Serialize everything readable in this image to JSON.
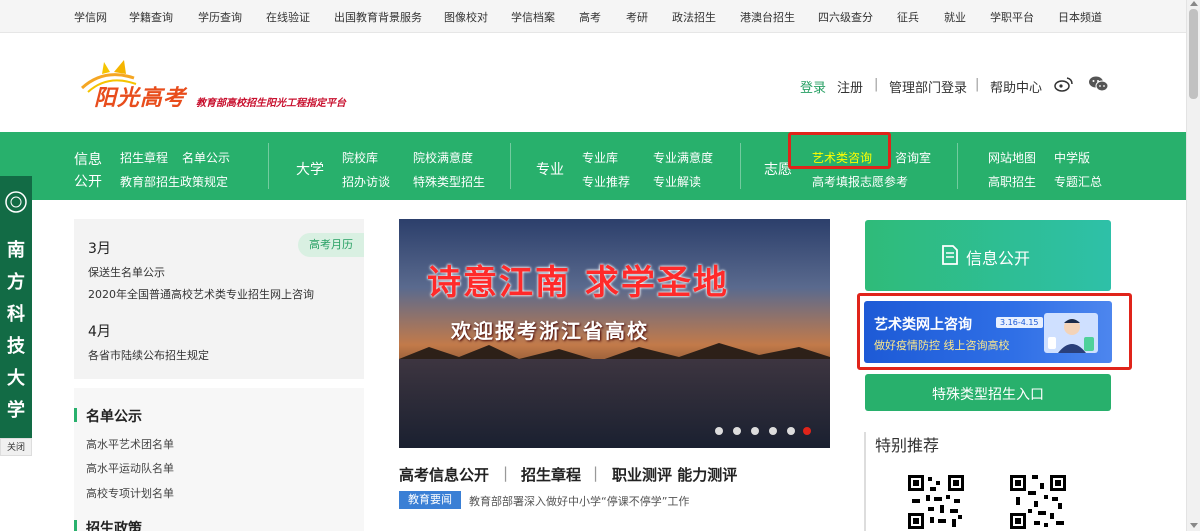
{
  "top_links": [
    "学信网",
    "学籍查询",
    "学历查询",
    "在线验证",
    "出国教育背景服务",
    "图像校对",
    "学信档案",
    "高考",
    "考研",
    "政法招生",
    "港澳台招生",
    "四六级查分",
    "征兵",
    "就业",
    "学职平台",
    "日本频道"
  ],
  "header": {
    "logo_title": "阳光高考",
    "logo_subtitle": "教育部高校招生阳光工程指定平台",
    "login": "登录",
    "register": "注册",
    "admin_login": "管理部门登录",
    "help": "帮助中心",
    "sep": "|"
  },
  "nav": {
    "info_label_1": "信息",
    "info_label_2": "公开",
    "info_links": [
      "招生章程",
      "名单公示",
      "教育部招生政策规定"
    ],
    "university_label": "大学",
    "university_links": [
      "院校库",
      "院校满意度",
      "招办访谈",
      "特殊类型招生"
    ],
    "major_label": "专业",
    "major_links": [
      "专业库",
      "专业满意度",
      "专业推荐",
      "专业解读"
    ],
    "volunteer_label": "志愿",
    "volunteer_links": [
      "艺术类咨询",
      "咨询室",
      "高考填报志愿参考"
    ],
    "other_links": [
      "网站地图",
      "中学版",
      "高职招生",
      "专题汇总"
    ]
  },
  "float_banner": {
    "chars": [
      "南",
      "方",
      "科",
      "技",
      "大",
      "学"
    ],
    "close": "关闭"
  },
  "calendar": {
    "badge": "高考月历",
    "month_1": "3月",
    "items_1": [
      "保送生名单公示",
      "2020年全国普通高校艺术类专业招生网上咨询"
    ],
    "month_2": "4月",
    "items_2": [
      "各省市陆续公布招生规定"
    ]
  },
  "namelist": {
    "title": "名单公示",
    "items": [
      "高水平艺术团名单",
      "高水平运动队名单",
      "高校专项计划名单"
    ]
  },
  "policy": {
    "title": "招生政策"
  },
  "banner": {
    "headline": "诗意江南  求学圣地",
    "subline": "欢迎报考浙江省高校",
    "slide_count": 6,
    "active_slide": 6
  },
  "news": {
    "links": [
      "高考信息公开",
      "招生章程",
      "职业测评 能力测评"
    ],
    "sep": "|",
    "tag": "教育要闻",
    "headline": "教育部部署深入做好中小学“停课不停学”工作"
  },
  "right": {
    "info_button": "信息公开",
    "art_title": "艺术类网上咨询",
    "art_date": "3.16-4.15",
    "art_sub": "做好疫情防控  线上咨询高校",
    "special_button": "特殊类型招生入口",
    "recommend_title": "特别推荐"
  },
  "colors": {
    "brand_green": "#28b06c",
    "highlight_red": "#e0241a",
    "art_blue": "#1d5ad6"
  }
}
